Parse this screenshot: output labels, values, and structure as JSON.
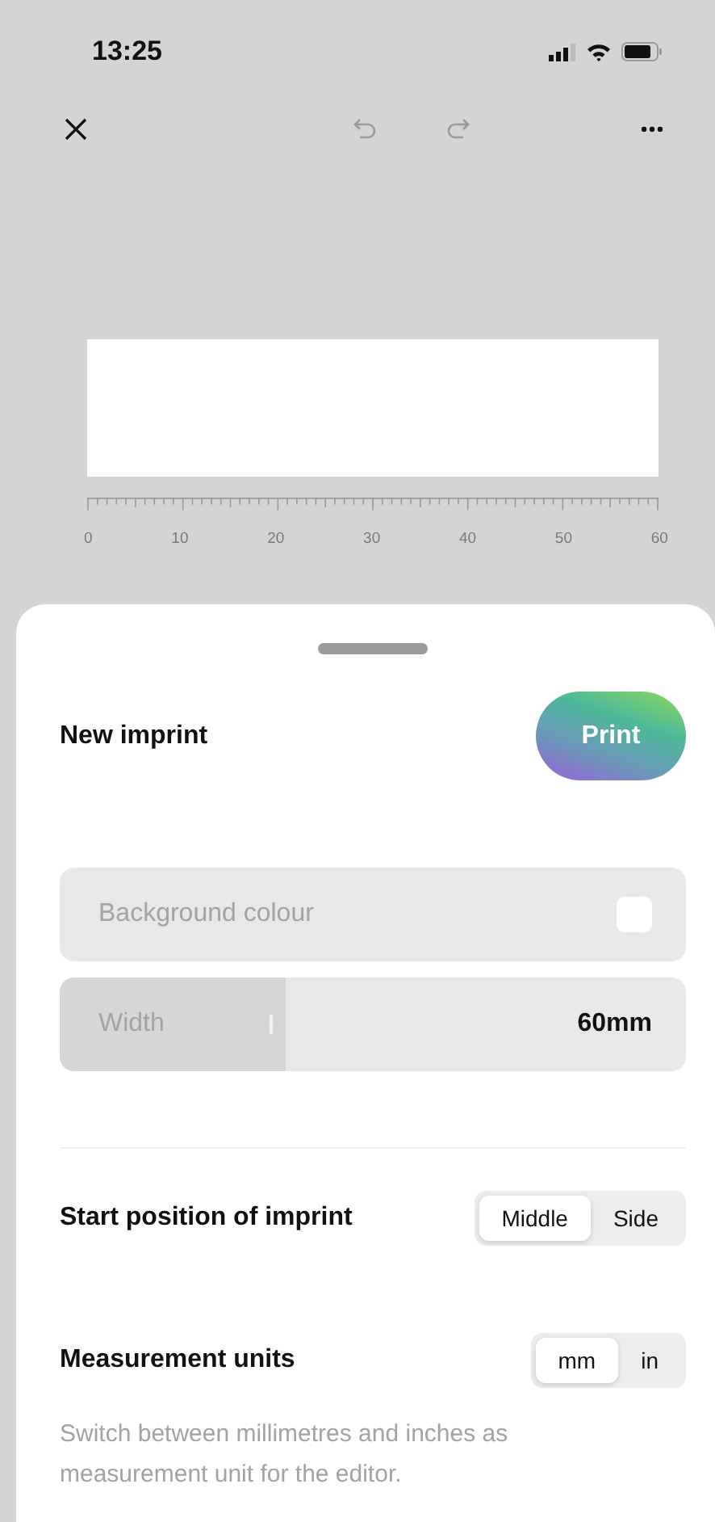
{
  "status_bar": {
    "time": "13:25"
  },
  "toolbar": {
    "undo_disabled": true,
    "redo_disabled": true
  },
  "ruler": {
    "labels": [
      "0",
      "10",
      "20",
      "30",
      "40",
      "50",
      "60"
    ]
  },
  "sheet": {
    "title": "New imprint",
    "print_button": "Print",
    "background_colour": {
      "label": "Background colour",
      "checked": false
    },
    "width": {
      "label": "Width",
      "value": "60mm",
      "level": 0.36
    },
    "settings": [
      {
        "label": "Start position of imprint",
        "options": [
          {
            "label": "Middle",
            "selected": true
          },
          {
            "label": "Side",
            "selected": false
          }
        ]
      },
      {
        "label": "Measurement units",
        "options": [
          {
            "label": "mm",
            "selected": true
          },
          {
            "label": "in",
            "selected": false
          }
        ],
        "description": "Switch between millimetres and inches as measurement unit for the editor."
      }
    ]
  }
}
